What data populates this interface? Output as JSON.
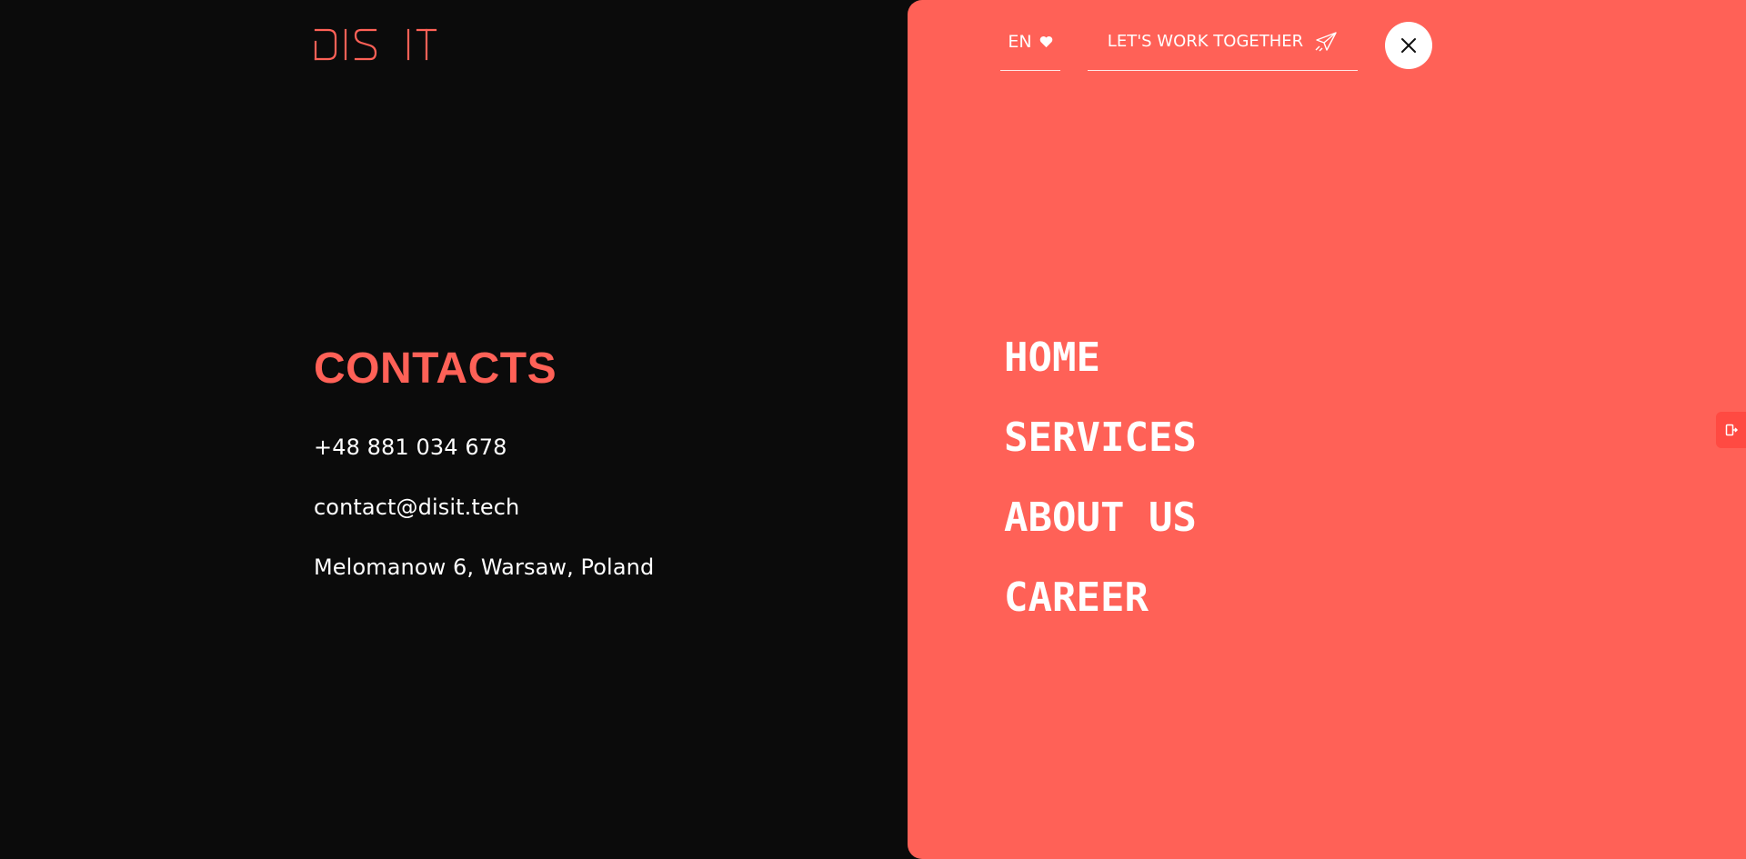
{
  "brand": {
    "logo_text": "DIS IT",
    "accent_color": "#ff6157",
    "background_color": "#0b0b0b"
  },
  "contacts": {
    "title": "CONTACTS",
    "phone": "+48 881 034 678",
    "email": "contact@disit.tech",
    "address": "Melomanow 6, Warsaw, Poland"
  },
  "header": {
    "language": "EN",
    "language_icon": "heart-icon",
    "cta_label": "LET'S WORK TOGETHER",
    "cta_icon": "paper-plane-icon",
    "close_icon": "close-icon"
  },
  "menu": {
    "items": [
      {
        "label": "HOME"
      },
      {
        "label": "SERVICES"
      },
      {
        "label": "ABOUT US"
      },
      {
        "label": "CAREER"
      }
    ]
  },
  "side_tab": {
    "icon": "exit-icon"
  }
}
